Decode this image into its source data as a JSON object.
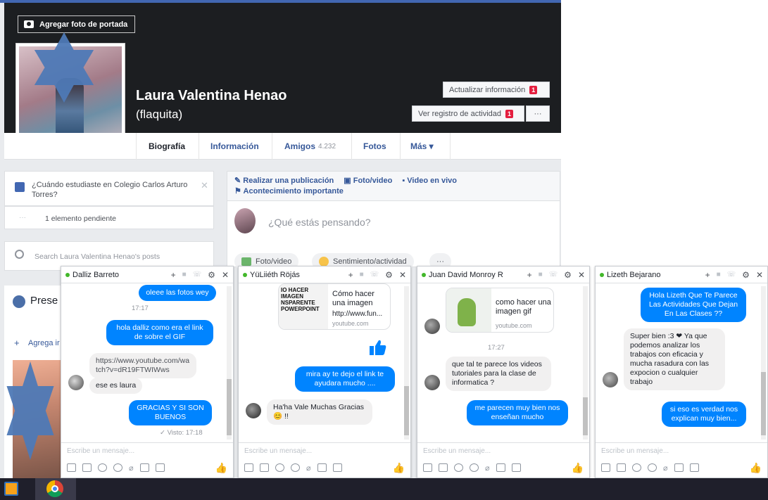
{
  "profile": {
    "cover_button": "Agregar foto de portada",
    "name": "Laura Valentina Henao",
    "nickname": "(flaquita)",
    "update_info": "Actualizar información",
    "update_badge": "1",
    "activity_log": "Ver registro de actividad",
    "activity_badge": "1",
    "more_dots": "···"
  },
  "tabs": {
    "bio": "Biografía",
    "info": "Información",
    "friends": "Amigos",
    "friends_count": "4.232",
    "photos": "Fotos",
    "more": "Más ▾"
  },
  "left": {
    "question": "¿Cuándo estudiaste en Colegio Carlos Arturo Torres?",
    "pending_dots": "···",
    "pending": "1 elemento pendiente",
    "search_placeholder": "Search Laura Valentina Henao's posts",
    "present_label": "Prese",
    "add_label": "Agrega ir"
  },
  "composer": {
    "post": "Realizar una publicación",
    "photo_video": "Foto/video",
    "live_video": "Video en vivo",
    "life_event": "Acontecimiento importante",
    "placeholder": "¿Qué estás pensando?",
    "pill_photo": "Foto/video",
    "pill_feeling": "Sentimiento/actividad",
    "pill_more": "···"
  },
  "chats": [
    {
      "name": "Dalliz Barreto",
      "messages": {
        "m1": "oleee las fotos wey",
        "t1": "17:17",
        "m2": "hola dalliz como era el link de sobre el GIF",
        "m3": "https://www.youtube.com/watch?v=dR19FTWIWws",
        "m4": "ese es laura",
        "m5": "GRACIAS Y SI SON BUENOS",
        "seen": "✓ Visto: 17:18"
      }
    },
    {
      "name": "YüLiiéth Röjás",
      "messages": {
        "card_thumb": "IO HACER IMAGEN NSPARENTE POWERPOINT",
        "card_title": "Cómo hacer una imagen",
        "card_url": "http://www.fun...",
        "card_domain": "youtube.com",
        "m1": "mira ay te dejo el link te ayudara mucho ....",
        "m2": "Ha'ha Vale Muchas Gracias 😊 !!"
      }
    },
    {
      "name": "Juan David Monroy R",
      "messages": {
        "card_title": "como hacer una imagen gif",
        "card_domain": "youtube.com",
        "t1": "17:27",
        "m1": "que tal te parece los videos tutoriales para la clase de informatica ?",
        "m2": "me parecen muy bien nos enseñan mucho"
      }
    },
    {
      "name": "Lizeth Bejarano",
      "messages": {
        "m1": "Hola Lizeth Que Te Parece Las Actividades Que Dejan En Las Clases ??",
        "m2": "Super bien :3 ❤ Ya que podemos analizar los trabajos con eficacia y mucha rasadura con las expocion o cualquier trabajo",
        "m3": "si eso es verdad nos explican muy bien..."
      }
    }
  ],
  "chat_common": {
    "input_placeholder": "Escribe un mensaje...",
    "head_icons": [
      "plus-icon",
      "video-icon",
      "phone-icon",
      "gear-icon",
      "close-icon"
    ]
  },
  "colors": {
    "fb_blue": "#4267b2",
    "messenger_blue": "#0084ff",
    "badge_red": "#e41e3f",
    "cover_dark": "#1c1e21"
  }
}
